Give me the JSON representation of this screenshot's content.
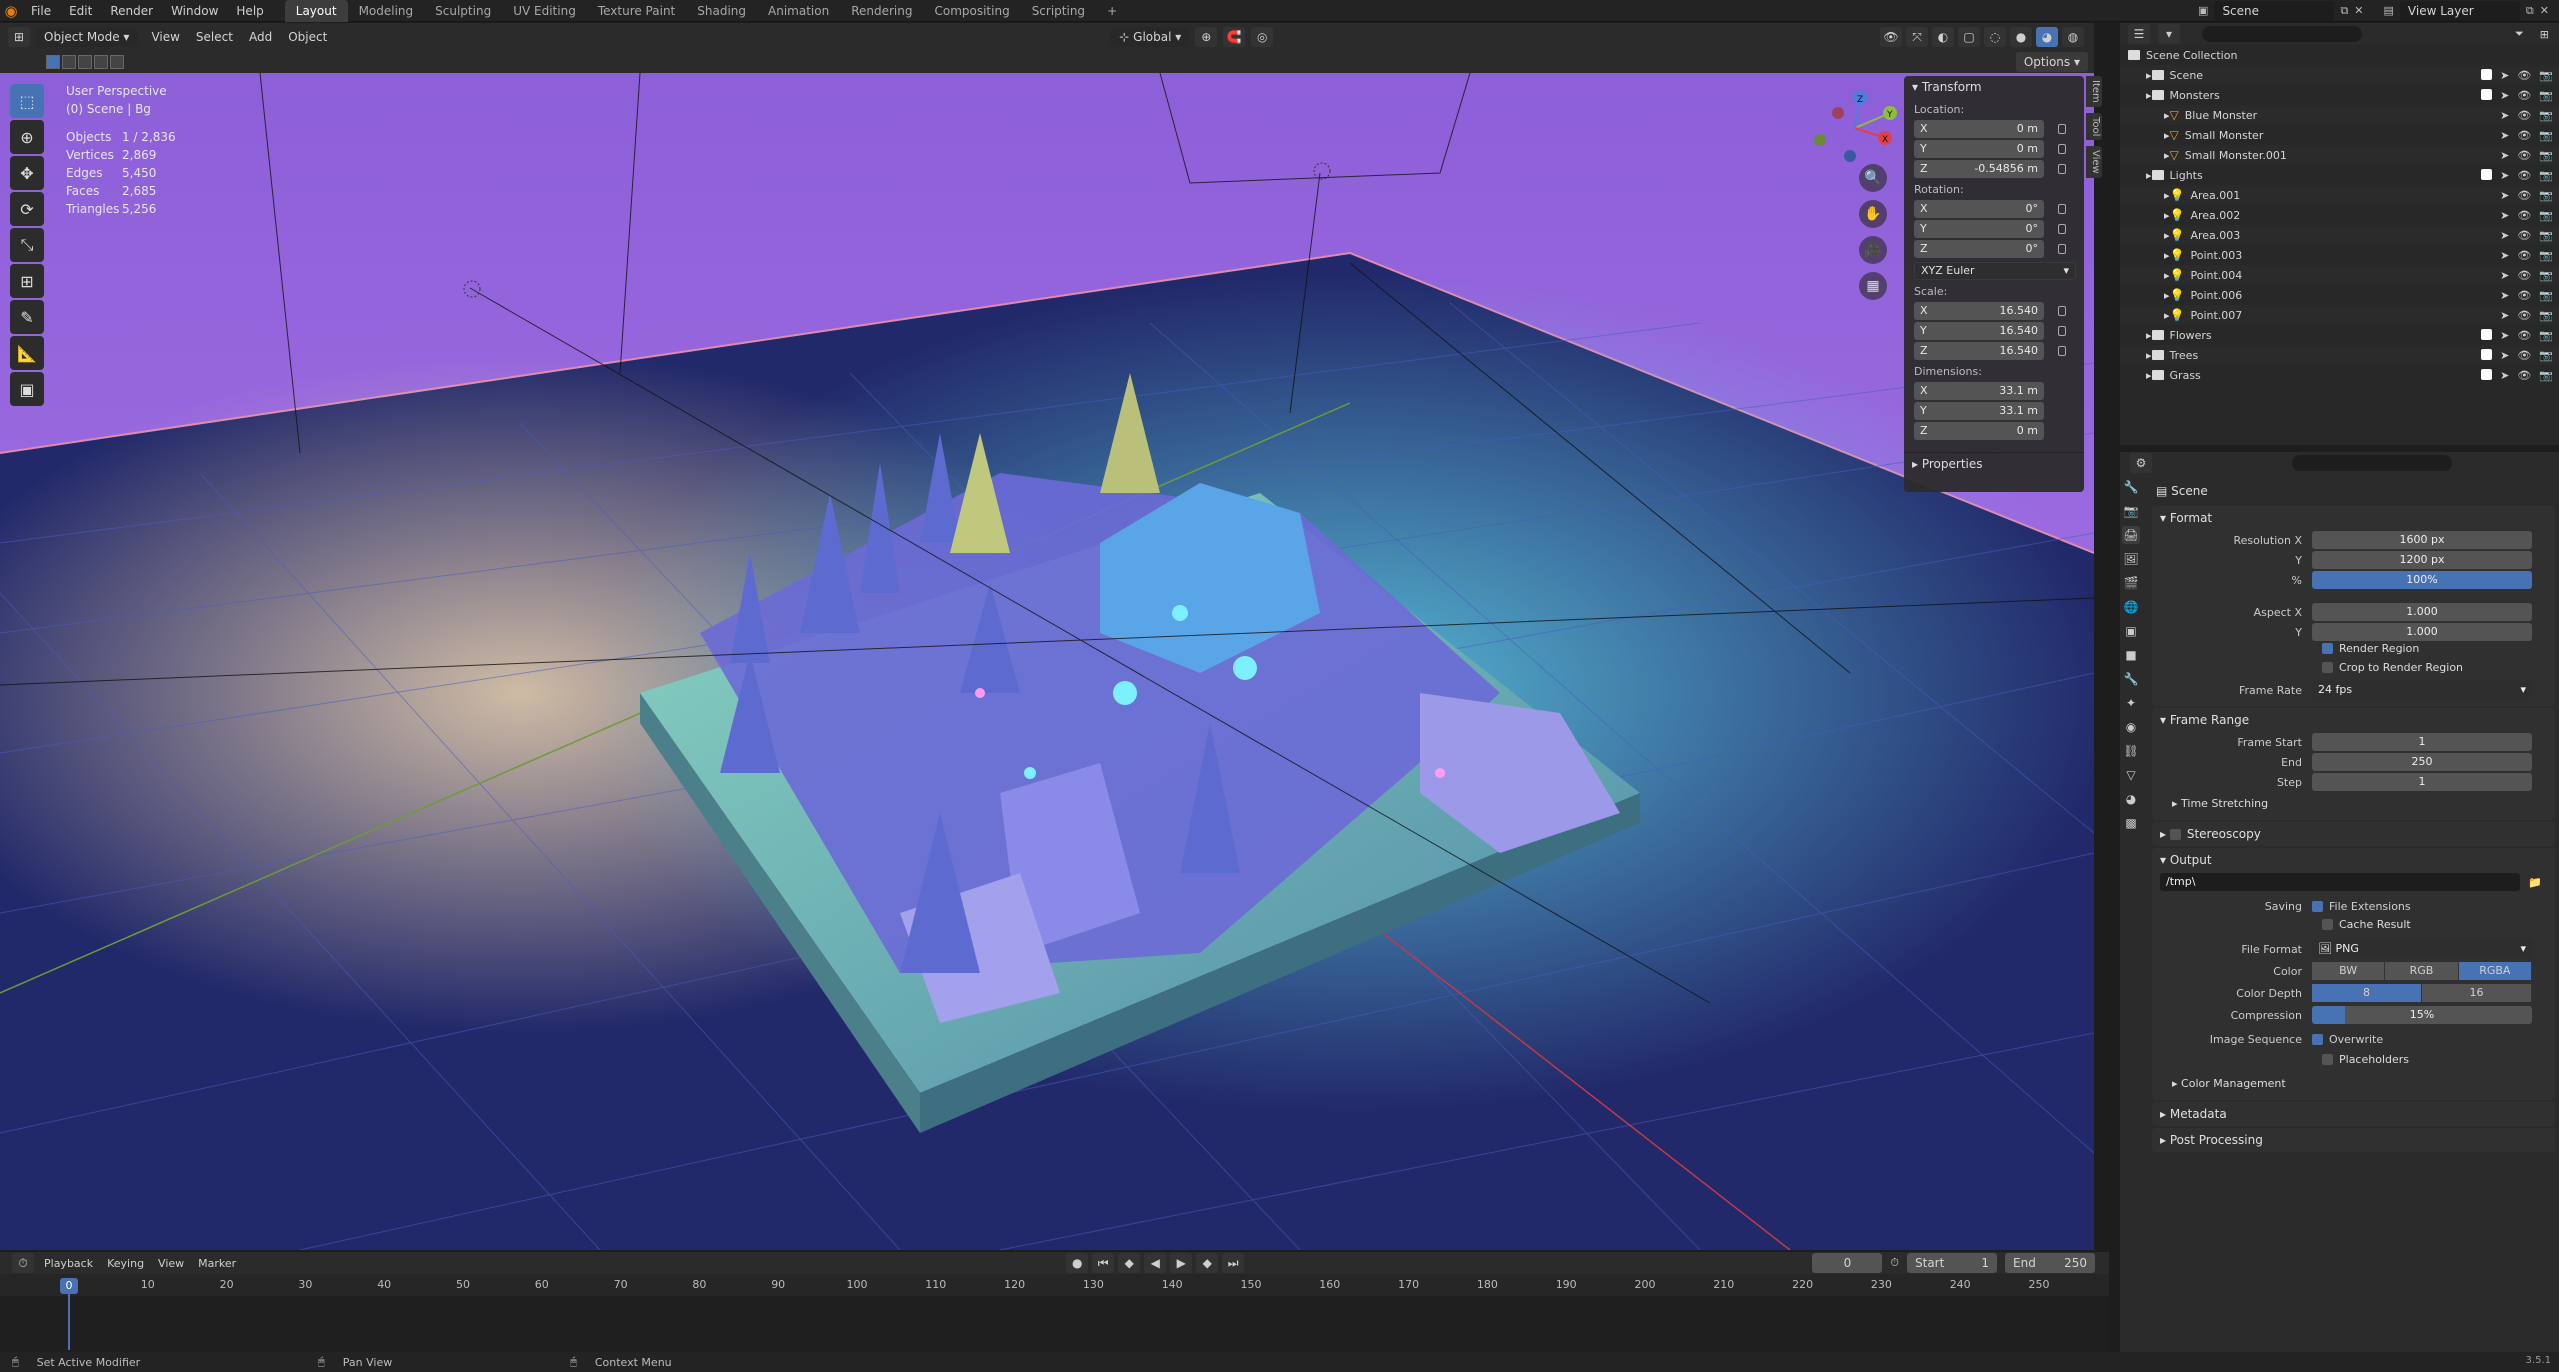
{
  "menu": [
    "File",
    "Edit",
    "Render",
    "Window",
    "Help"
  ],
  "workspaces": [
    "Layout",
    "Modeling",
    "Sculpting",
    "UV Editing",
    "Texture Paint",
    "Shading",
    "Animation",
    "Rendering",
    "Compositing",
    "Scripting"
  ],
  "active_workspace": "Layout",
  "top_right": {
    "scene": "Scene",
    "view_layer": "View Layer"
  },
  "viewport_header": {
    "mode": "Object Mode",
    "menus": [
      "View",
      "Select",
      "Add",
      "Object"
    ],
    "transform_orientation": "Global",
    "options": "Options"
  },
  "viewport_info": {
    "perspective": "User Perspective",
    "scene": "(0) Scene | Bg",
    "stats": [
      {
        "k": "Objects",
        "v": "1 / 2,836"
      },
      {
        "k": "Vertices",
        "v": "2,869"
      },
      {
        "k": "Edges",
        "v": "5,450"
      },
      {
        "k": "Faces",
        "v": "2,685"
      },
      {
        "k": "Triangles",
        "v": "5,256"
      }
    ]
  },
  "npanel": {
    "title": "Transform",
    "location_label": "Location:",
    "location": [
      {
        "a": "X",
        "v": "0 m"
      },
      {
        "a": "Y",
        "v": "0 m"
      },
      {
        "a": "Z",
        "v": "-0.54856 m"
      }
    ],
    "rotation_label": "Rotation:",
    "rotation": [
      {
        "a": "X",
        "v": "0°"
      },
      {
        "a": "Y",
        "v": "0°"
      },
      {
        "a": "Z",
        "v": "0°"
      }
    ],
    "rotation_mode": "XYZ Euler",
    "scale_label": "Scale:",
    "scale": [
      {
        "a": "X",
        "v": "16.540"
      },
      {
        "a": "Y",
        "v": "16.540"
      },
      {
        "a": "Z",
        "v": "16.540"
      }
    ],
    "dimensions_label": "Dimensions:",
    "dimensions": [
      {
        "a": "X",
        "v": "33.1 m"
      },
      {
        "a": "Y",
        "v": "33.1 m"
      },
      {
        "a": "Z",
        "v": "0 m"
      }
    ],
    "properties": "Properties",
    "tabs": [
      "Item",
      "Tool",
      "View"
    ]
  },
  "outliner": {
    "rows": [
      {
        "name": "Scene Collection",
        "type": "collection",
        "indent": 0
      },
      {
        "name": "Scene",
        "type": "collection",
        "indent": 1
      },
      {
        "name": "Monsters",
        "type": "collection",
        "indent": 1
      },
      {
        "name": "Blue Monster",
        "type": "object",
        "indent": 2
      },
      {
        "name": "Small Monster",
        "type": "object",
        "indent": 2
      },
      {
        "name": "Small Monster.001",
        "type": "object",
        "indent": 2
      },
      {
        "name": "Lights",
        "type": "collection",
        "indent": 1
      },
      {
        "name": "Area.001",
        "type": "light",
        "indent": 2
      },
      {
        "name": "Area.002",
        "type": "light",
        "indent": 2
      },
      {
        "name": "Area.003",
        "type": "light",
        "indent": 2
      },
      {
        "name": "Point.003",
        "type": "light",
        "indent": 2
      },
      {
        "name": "Point.004",
        "type": "light",
        "indent": 2
      },
      {
        "name": "Point.006",
        "type": "light",
        "indent": 2
      },
      {
        "name": "Point.007",
        "type": "light",
        "indent": 2
      },
      {
        "name": "Flowers",
        "type": "collection",
        "indent": 1
      },
      {
        "name": "Trees",
        "type": "collection",
        "indent": 1
      },
      {
        "name": "Grass",
        "type": "collection",
        "indent": 1
      }
    ]
  },
  "properties": {
    "context": "Scene",
    "format": {
      "title": "Format",
      "rows": [
        {
          "label": "Resolution X",
          "value": "1600 px",
          "hl": false
        },
        {
          "label": "Y",
          "value": "1200 px",
          "hl": false
        },
        {
          "label": "%",
          "value": "100%",
          "hl": true
        },
        {
          "label": "Aspect X",
          "value": "1.000",
          "hl": false
        },
        {
          "label": "Y",
          "value": "1.000",
          "hl": false
        }
      ],
      "render_region": "Render Region",
      "crop": "Crop to Render Region",
      "frame_rate_label": "Frame Rate",
      "frame_rate": "24 fps"
    },
    "frame_range": {
      "title": "Frame Range",
      "rows": [
        {
          "label": "Frame Start",
          "value": "1"
        },
        {
          "label": "End",
          "value": "250"
        },
        {
          "label": "Step",
          "value": "1"
        }
      ],
      "time_stretching": "Time Stretching"
    },
    "stereoscopy": "Stereoscopy",
    "output": {
      "title": "Output",
      "path": "/tmp\\",
      "saving_label": "Saving",
      "file_extensions": "File Extensions",
      "cache_result": "Cache Result",
      "file_format_label": "File Format",
      "file_format": "PNG",
      "color_label": "Color",
      "color_options": [
        "BW",
        "RGB",
        "RGBA"
      ],
      "color_selected": "RGBA",
      "color_depth_label": "Color Depth",
      "color_depth_options": [
        "8",
        "16"
      ],
      "compression_label": "Compression",
      "compression": "15%",
      "compression_level": 0.15,
      "image_sequence_label": "Image Sequence",
      "overwrite": "Overwrite",
      "placeholders": "Placeholders",
      "color_management": "Color Management"
    },
    "metadata": "Metadata",
    "post_processing": "Post Processing"
  },
  "timeline": {
    "menus": [
      "Playback",
      "Keying",
      "View",
      "Marker"
    ],
    "current_frame": "0",
    "start_label": "Start",
    "start": "1",
    "end_label": "End",
    "end": "250",
    "ticks": [
      "0",
      "10",
      "20",
      "30",
      "40",
      "50",
      "60",
      "70",
      "80",
      "90",
      "100",
      "110",
      "120",
      "130",
      "140",
      "150",
      "160",
      "170",
      "180",
      "190",
      "200",
      "210",
      "220",
      "230",
      "240",
      "250"
    ]
  },
  "statusbar": [
    "Set Active Modifier",
    "Pan View",
    "Context Menu"
  ],
  "version": "3.5.1",
  "colors": {
    "accent": "#4772b3",
    "wall": "#8e5ed6",
    "floor": "#1f2660",
    "grid": "#3a4aa6"
  }
}
